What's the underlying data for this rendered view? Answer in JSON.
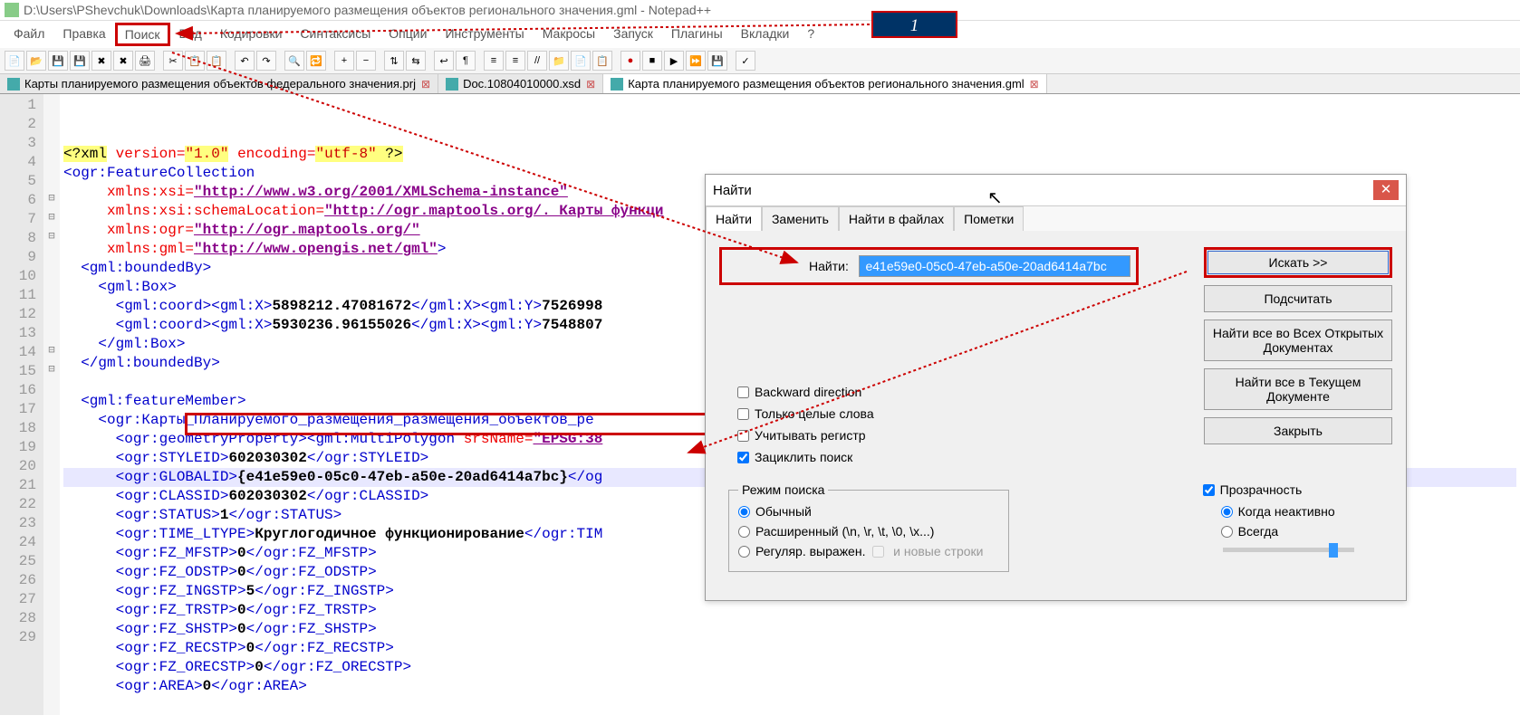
{
  "window": {
    "title": "D:\\Users\\PShevchuk\\Downloads\\Карта планируемого размещения объектов регионального значения.gml - Notepad++",
    "callout_label": "1"
  },
  "menu": {
    "items": [
      "Файл",
      "Правка",
      "Поиск",
      "Вид",
      "Кодировки",
      "Синтаксисы",
      "Опции",
      "Инструменты",
      "Макросы",
      "Запуск",
      "Плагины",
      "Вкладки",
      "?"
    ],
    "highlighted_index": 2
  },
  "tabs": [
    {
      "label": "Карты планируемого размещения объектов федерального значения.prj",
      "active": false
    },
    {
      "label": "Doc.10804010000.xsd",
      "active": false
    },
    {
      "label": "Карта планируемого размещения объектов регионального значения.gml",
      "active": true
    }
  ],
  "code": {
    "lines": [
      {
        "n": 1,
        "fold": "",
        "html": "<span class='xml-decl'>&lt;?xml</span> <span class='xml-attr'>version=</span><span class='xml-decl'><span class='q'>\"1.0\"</span></span> <span class='xml-attr'>encoding=</span><span class='xml-decl'><span class='q'>\"utf-8\"</span> ?&gt;</span>"
      },
      {
        "n": 2,
        "fold": "",
        "html": "<span class='xml-tag'>&lt;ogr:FeatureCollection</span>"
      },
      {
        "n": 3,
        "fold": "",
        "html": "     <span class='xml-attr'>xmlns:xsi=</span><span class='xml-str'>\"http://www.w3.org/2001/XMLSchema-instance\"</span>"
      },
      {
        "n": 4,
        "fold": "",
        "html": "     <span class='xml-attr'>xmlns:xsi:schemaLocation=</span><span class='xml-str'>\"http://ogr.maptools.org/. Карты функци</span>"
      },
      {
        "n": 5,
        "fold": "",
        "html": "     <span class='xml-attr'>xmlns:ogr=</span><span class='xml-str'>\"http://ogr.maptools.org/\"</span>"
      },
      {
        "n": 6,
        "fold": "⊟",
        "html": "     <span class='xml-attr'>xmlns:gml=</span><span class='xml-str'>\"http://www.opengis.net/gml\"</span><span class='xml-tag'>&gt;</span>"
      },
      {
        "n": 7,
        "fold": "⊟",
        "html": "  <span class='xml-tag'>&lt;gml:boundedBy&gt;</span>"
      },
      {
        "n": 8,
        "fold": "⊟",
        "html": "    <span class='xml-tag'>&lt;gml:Box&gt;</span>"
      },
      {
        "n": 9,
        "fold": "",
        "html": "      <span class='xml-tag'>&lt;gml:coord&gt;&lt;gml:X&gt;</span><span class='xml-text'>5898212.47081672</span><span class='xml-tag'>&lt;/gml:X&gt;&lt;gml:Y&gt;</span><span class='xml-text'>7526998</span>"
      },
      {
        "n": 10,
        "fold": "",
        "html": "      <span class='xml-tag'>&lt;gml:coord&gt;&lt;gml:X&gt;</span><span class='xml-text'>5930236.96155026</span><span class='xml-tag'>&lt;/gml:X&gt;&lt;gml:Y&gt;</span><span class='xml-text'>7548807</span>"
      },
      {
        "n": 11,
        "fold": "",
        "html": "    <span class='xml-tag'>&lt;/gml:Box&gt;</span>"
      },
      {
        "n": 12,
        "fold": "",
        "html": "  <span class='xml-tag'>&lt;/gml:boundedBy&gt;</span>"
      },
      {
        "n": 13,
        "fold": "",
        "html": ""
      },
      {
        "n": 14,
        "fold": "⊟",
        "html": "  <span class='xml-tag'>&lt;gml:featureMember&gt;</span>"
      },
      {
        "n": 15,
        "fold": "⊟",
        "html": "    <span class='xml-tag'>&lt;ogr:Карты_Планируемого_размещения_размещения_объектов_ре</span>"
      },
      {
        "n": 16,
        "fold": "",
        "html": "      <span class='xml-tag'>&lt;ogr:geometryProperty&gt;&lt;gml:MultiPolygon</span> <span class='xml-attr'>srsName=</span><span class='xml-str'>\"EPSG:38</span>"
      },
      {
        "n": 17,
        "fold": "",
        "html": "      <span class='xml-tag'>&lt;ogr:STYLEID&gt;</span><span class='xml-text'>602030302</span><span class='xml-tag'>&lt;/ogr:STYLEID&gt;</span>"
      },
      {
        "n": 18,
        "fold": "",
        "html": "      <span class='xml-tag'>&lt;ogr:GLOBALID&gt;</span><span class='xml-text'>{e41e59e0-05c0-47eb-a50e-20ad6414a7bc}</span><span class='xml-tag'>&lt;/og</span>",
        "current": true
      },
      {
        "n": 19,
        "fold": "",
        "html": "      <span class='xml-tag'>&lt;ogr:CLASSID&gt;</span><span class='xml-text'>602030302</span><span class='xml-tag'>&lt;/ogr:CLASSID&gt;</span>"
      },
      {
        "n": 20,
        "fold": "",
        "html": "      <span class='xml-tag'>&lt;ogr:STATUS&gt;</span><span class='xml-text'>1</span><span class='xml-tag'>&lt;/ogr:STATUS&gt;</span>"
      },
      {
        "n": 21,
        "fold": "",
        "html": "      <span class='xml-tag'>&lt;ogr:TIME_LTYPE&gt;</span><span class='xml-text'>Круглогодичное функционирование</span><span class='xml-tag'>&lt;/ogr:TIM</span>"
      },
      {
        "n": 22,
        "fold": "",
        "html": "      <span class='xml-tag'>&lt;ogr:FZ_MFSTP&gt;</span><span class='xml-text'>0</span><span class='xml-tag'>&lt;/ogr:FZ_MFSTP&gt;</span>"
      },
      {
        "n": 23,
        "fold": "",
        "html": "      <span class='xml-tag'>&lt;ogr:FZ_ODSTP&gt;</span><span class='xml-text'>0</span><span class='xml-tag'>&lt;/ogr:FZ_ODSTP&gt;</span>"
      },
      {
        "n": 24,
        "fold": "",
        "html": "      <span class='xml-tag'>&lt;ogr:FZ_INGSTP&gt;</span><span class='xml-text'>5</span><span class='xml-tag'>&lt;/ogr:FZ_INGSTP&gt;</span>"
      },
      {
        "n": 25,
        "fold": "",
        "html": "      <span class='xml-tag'>&lt;ogr:FZ_TRSTP&gt;</span><span class='xml-text'>0</span><span class='xml-tag'>&lt;/ogr:FZ_TRSTP&gt;</span>"
      },
      {
        "n": 26,
        "fold": "",
        "html": "      <span class='xml-tag'>&lt;ogr:FZ_SHSTP&gt;</span><span class='xml-text'>0</span><span class='xml-tag'>&lt;/ogr:FZ_SHSTP&gt;</span>"
      },
      {
        "n": 27,
        "fold": "",
        "html": "      <span class='xml-tag'>&lt;ogr:FZ_RECSTP&gt;</span><span class='xml-text'>0</span><span class='xml-tag'>&lt;/ogr:FZ_RECSTP&gt;</span>"
      },
      {
        "n": 28,
        "fold": "",
        "html": "      <span class='xml-tag'>&lt;ogr:FZ_ORECSTP&gt;</span><span class='xml-text'>0</span><span class='xml-tag'>&lt;/ogr:FZ_ORECSTP&gt;</span>"
      },
      {
        "n": 29,
        "fold": "",
        "html": "      <span class='xml-tag'>&lt;ogr:AREA&gt;</span><span class='xml-text'>0</span><span class='xml-tag'>&lt;/ogr:AREA&gt;</span>"
      }
    ]
  },
  "find": {
    "title": "Найти",
    "tabs": [
      "Найти",
      "Заменить",
      "Найти в файлах",
      "Пометки"
    ],
    "find_label": "Найти:",
    "find_value": "e41e59e0-05c0-47eb-a50e-20ad6414a7bc",
    "buttons": {
      "search": "Искать >>",
      "count": "Подсчитать",
      "find_all_open": "Найти все во Всех Открытых Документах",
      "find_all_current": "Найти все в Текущем Документе",
      "close": "Закрыть"
    },
    "checkboxes": {
      "backward": "Backward direction",
      "whole_word": "Только целые слова",
      "match_case": "Учитывать регистр",
      "wrap": "Зациклить поиск"
    },
    "mode_legend": "Режим поиска",
    "modes": {
      "normal": "Обычный",
      "extended": "Расширенный (\\n, \\r, \\t, \\0, \\x...)",
      "regex": "Регуляр. выражен.",
      "regex_newline": "и новые строки"
    },
    "transparency": {
      "label": "Прозрачность",
      "when_inactive": "Когда неактивно",
      "always": "Всегда"
    }
  }
}
